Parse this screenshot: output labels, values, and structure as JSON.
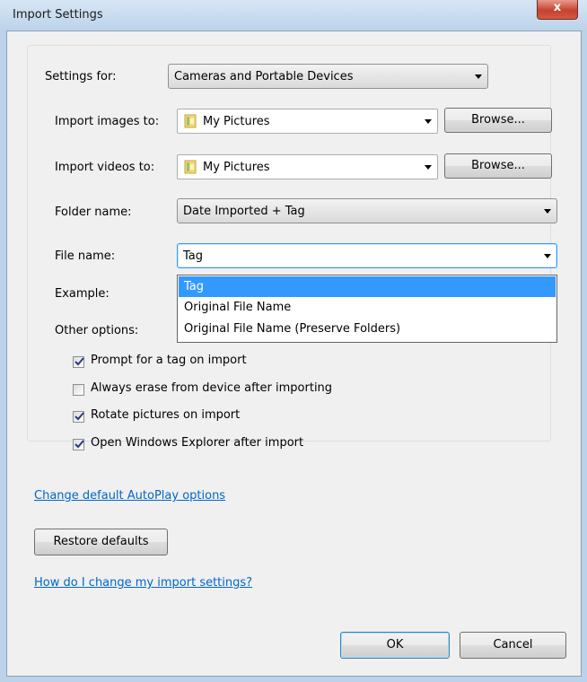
{
  "window": {
    "title": "Import Settings",
    "close_glyph": "x"
  },
  "settings_for": {
    "label": "Settings for:",
    "value": "Cameras and Portable Devices"
  },
  "import_images": {
    "label": "Import images to:",
    "value": "My Pictures",
    "browse": "Browse..."
  },
  "import_videos": {
    "label": "Import videos to:",
    "value": "My Pictures",
    "browse": "Browse..."
  },
  "folder_name": {
    "label": "Folder name:",
    "value": "Date Imported + Tag"
  },
  "file_name": {
    "label": "File name:",
    "value": "Tag",
    "options": [
      "Tag",
      "Original File Name",
      "Original File Name (Preserve Folders)"
    ]
  },
  "example": {
    "label": "Example:"
  },
  "other_options": {
    "label": "Other options:"
  },
  "checkboxes": [
    {
      "label": "Prompt for a tag on import",
      "checked": true
    },
    {
      "label": "Always erase from device after importing",
      "checked": false
    },
    {
      "label": "Rotate pictures on import",
      "checked": true
    },
    {
      "label": "Open Windows Explorer after import",
      "checked": true
    }
  ],
  "links": {
    "autoplay": "Change default AutoPlay options",
    "help": "How do I change my import settings?"
  },
  "buttons": {
    "restore": "Restore defaults",
    "ok": "OK",
    "cancel": "Cancel"
  },
  "icons": {
    "folder": "folder-icon",
    "check": "checkmark-icon",
    "dropdown": "chevron-down-icon"
  },
  "colors": {
    "accent": "#3399ff",
    "link": "#0066cc"
  }
}
